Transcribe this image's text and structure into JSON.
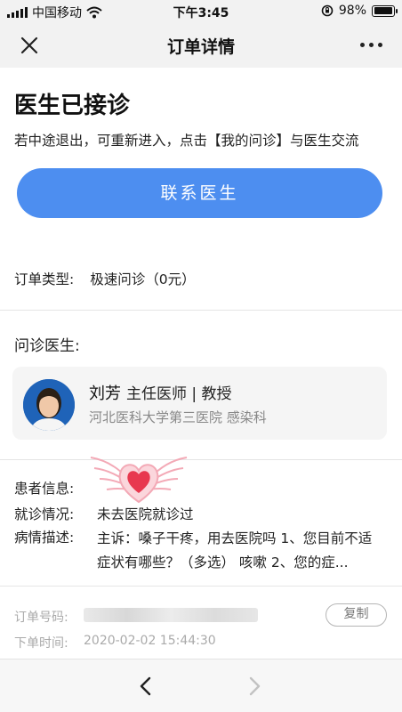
{
  "status_bar": {
    "carrier": "中国移动",
    "time": "下午3:45",
    "battery_text": "98%",
    "battery_level": 0.98,
    "icons": [
      "signal-icon",
      "wifi-icon",
      "rotation-lock-icon",
      "battery-icon"
    ]
  },
  "nav": {
    "title": "订单详情",
    "close_icon": "close-icon",
    "more_icon": "more-icon"
  },
  "consult": {
    "status": "医生已接诊",
    "hint": "若中途退出，可重新进入，点击【我的问诊】与医生交流",
    "contact_button": "联系医生"
  },
  "order_type": {
    "label": "订单类型:",
    "value": "极速问诊（0元）"
  },
  "doctor": {
    "section_title": "问诊医生:",
    "name": "刘芳",
    "title": "主任医师 | 教授",
    "hospital": "河北医科大学第三医院 感染科"
  },
  "patient": {
    "info_label": "患者信息:",
    "visit_label": "就诊情况:",
    "visit_value": "未去医院就诊过",
    "desc_label": "病情描述:",
    "desc_value": "主诉：嗓子干疼，用去医院吗 1、您目前不适症状有哪些？（多选） 咳嗽 2、您的症..."
  },
  "order_meta": {
    "number_label": "订单号码:",
    "copy_button": "复制",
    "time_label": "下单时间:",
    "time_value": "2020-02-02 15:44:30"
  },
  "colors": {
    "accent": "#4d8ef0",
    "nav_background": "#f2f2f2",
    "heart": "#e8384f"
  }
}
